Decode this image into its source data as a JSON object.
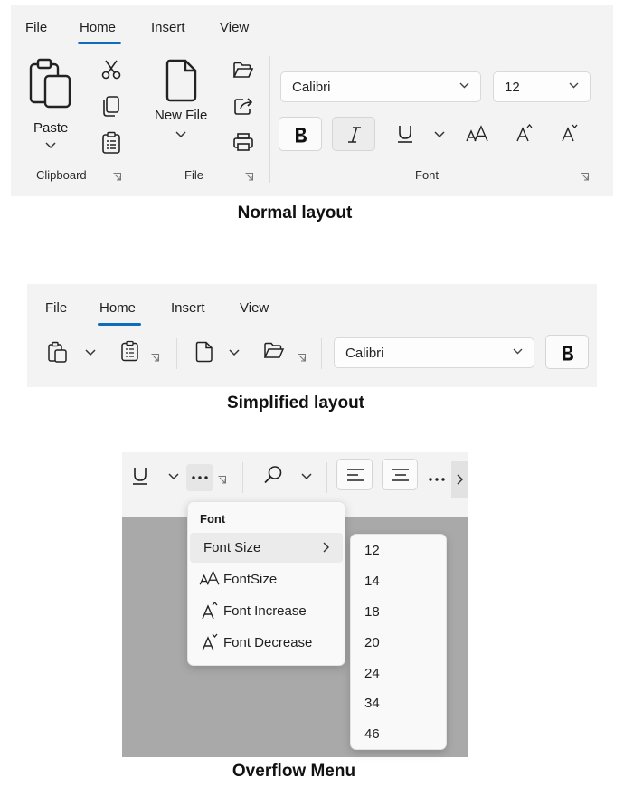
{
  "normal": {
    "tabs": [
      "File",
      "Home",
      "Insert",
      "View"
    ],
    "clipboard": {
      "paste_label": "Paste",
      "group_label": "Clipboard"
    },
    "file": {
      "new_file_label": "New File",
      "group_label": "File"
    },
    "font": {
      "font_name": "Calibri",
      "font_size": "12",
      "group_label": "Font"
    },
    "caption": "Normal layout"
  },
  "simplified": {
    "tabs": [
      "File",
      "Home",
      "Insert",
      "View"
    ],
    "font_name": "Calibri",
    "caption": "Simplified layout"
  },
  "overflow": {
    "menu_header": "Font",
    "items": [
      "Font Size",
      "FontSize",
      "Font Increase",
      "Font Decrease"
    ],
    "sizes": [
      "12",
      "14",
      "18",
      "20",
      "24",
      "34",
      "46"
    ],
    "caption": "Overflow Menu"
  },
  "colors": {
    "accent": "#0f6cbd",
    "panel": "#f3f3f3",
    "overlay": "#a9a9a9"
  }
}
